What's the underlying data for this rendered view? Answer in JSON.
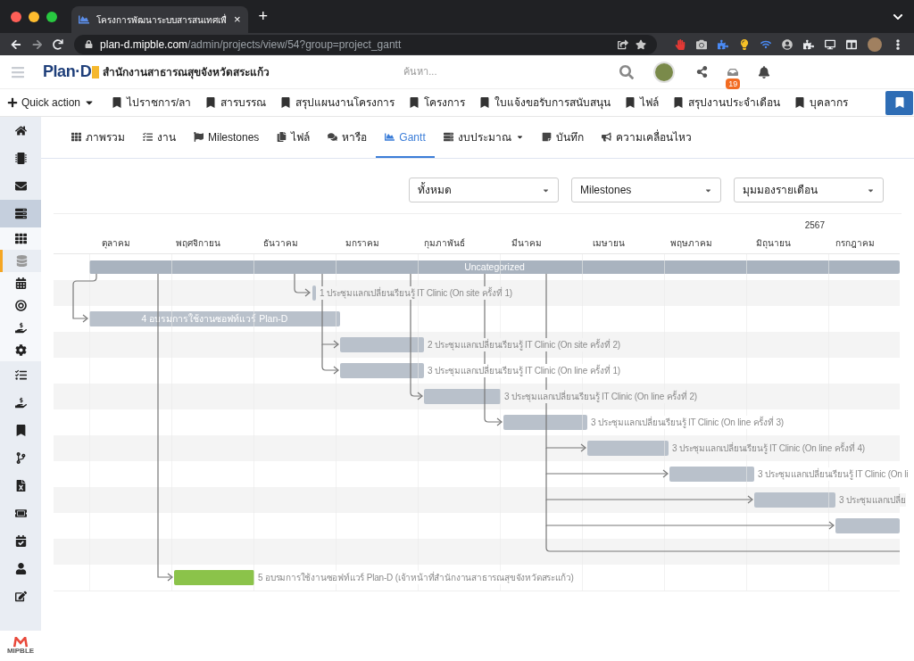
{
  "browser": {
    "tab_title": "โครงการพัฒนาระบบสารสนเทศเพื่",
    "tab_close": "×",
    "new_tab": "+",
    "url_host": "plan-d.mipble.com",
    "url_path": "/admin/projects/view/54?group=project_gantt"
  },
  "header": {
    "logo": "Plan·D",
    "organization": "สำนักงานสาธารณสุขจังหวัดสระแก้ว",
    "search": {
      "placeholder": "ค้นหา..."
    },
    "inbox_badge": "19"
  },
  "quick_bar": {
    "quick_action": "Quick action",
    "items": [
      "ไปราชการ/ลา",
      "สารบรรณ",
      "สรุปแผนงานโครงการ",
      "โครงการ",
      "ใบแจ้งขอรับการสนับสนุน",
      "ไฟล์",
      "สรุปงานประจำเดือน",
      "บุคลากร"
    ]
  },
  "sidebar": {
    "items": [
      {
        "kind": "main",
        "selected": false
      },
      {
        "kind": "main",
        "selected": false
      },
      {
        "kind": "main",
        "selected": false
      },
      {
        "kind": "main",
        "selected": true
      },
      {
        "kind": "sub",
        "selected": false
      },
      {
        "kind": "sub",
        "selected": true
      },
      {
        "kind": "sub",
        "selected": false
      },
      {
        "kind": "sub",
        "selected": false
      },
      {
        "kind": "sub",
        "selected": false
      },
      {
        "kind": "sub",
        "selected": false
      },
      {
        "kind": "main",
        "selected": false
      },
      {
        "kind": "main",
        "selected": false
      },
      {
        "kind": "main",
        "selected": false
      },
      {
        "kind": "main",
        "selected": false
      },
      {
        "kind": "main",
        "selected": false
      },
      {
        "kind": "main",
        "selected": false
      },
      {
        "kind": "main",
        "selected": false
      },
      {
        "kind": "main",
        "selected": false
      },
      {
        "kind": "main",
        "selected": false
      }
    ],
    "logo": "MIPBLE"
  },
  "tabs": [
    {
      "label": "ภาพรวม",
      "selected": false,
      "dropdown": false
    },
    {
      "label": "งาน",
      "selected": false,
      "dropdown": false
    },
    {
      "label": "Milestones",
      "selected": false,
      "dropdown": false
    },
    {
      "label": "ไฟล์",
      "selected": false,
      "dropdown": false
    },
    {
      "label": "หารือ",
      "selected": false,
      "dropdown": false
    },
    {
      "label": "Gantt",
      "selected": true,
      "dropdown": false
    },
    {
      "label": "งบประมาณ",
      "selected": false,
      "dropdown": true
    },
    {
      "label": "บันทึก",
      "selected": false,
      "dropdown": false
    },
    {
      "label": "ความเคลื่อนไหว",
      "selected": false,
      "dropdown": false
    }
  ],
  "filters": [
    {
      "value": "ทั้งหมด"
    },
    {
      "value": "Milestones"
    },
    {
      "value": "มุมมองรายเดือน"
    }
  ],
  "gantt": {
    "year": "2567",
    "months": [
      "ตุลาคม",
      "พฤศจิกายน",
      "ธันวาคม",
      "มกราคม",
      "กุมภาพันธ์",
      "มีนาคม",
      "เมษายน",
      "พฤษภาคม",
      "มิถุนายน",
      "กรกฎาคม"
    ],
    "rows": [
      {
        "kind": "group",
        "label": "Uncategorized",
        "color": "#a9b3bf"
      },
      {
        "kind": "task",
        "label": "1 ประชุมแลกเปลี่ยนเรียนรู้ IT Clinic (On site ครั้งที่ 1)",
        "color": "#b9c1cb"
      },
      {
        "kind": "inline",
        "label": "4 อบรมการใช้งานซอฟท์แวร์ Plan-D",
        "color": "#b9c1cb"
      },
      {
        "kind": "task",
        "label": "2 ประชุมแลกเปลี่ยนเรียนรู้ IT Clinic (On site ครั้งที่ 2)",
        "color": "#b9c1cb"
      },
      {
        "kind": "task",
        "label": "3 ประชุมแลกเปลี่ยนเรียนรู้ IT Clinic (On line ครั้งที่ 1)",
        "color": "#b9c1cb"
      },
      {
        "kind": "task",
        "label": "3 ประชุมแลกเปลี่ยนเรียนรู้ IT Clinic (On line ครั้งที่ 2)",
        "color": "#b9c1cb"
      },
      {
        "kind": "task",
        "label": "3 ประชุมแลกเปลี่ยนเรียนรู้ IT Clinic (On line ครั้งที่ 3)",
        "color": "#b9c1cb"
      },
      {
        "kind": "task",
        "label": "3 ประชุมแลกเปลี่ยนเรียนรู้ IT Clinic (On line ครั้งที่ 4)",
        "color": "#b9c1cb"
      },
      {
        "kind": "task",
        "label": "3 ประชุมแลกเปลี่ยนเรียนรู้ IT Clinic (On li",
        "color": "#b9c1cb"
      },
      {
        "kind": "task",
        "label": "3 ประชุมแลกเปลี่ย",
        "color": "#b9c1cb"
      },
      {
        "kind": "task",
        "color": "#b9c1cb"
      },
      {
        "kind": "empty"
      },
      {
        "kind": "task",
        "label": "5 อบรมการใช้งานซอฟท์แวร์ Plan-D (เจ้าหน้าที่สำนักงานสาธารณสุขจังหวัดสระแก้ว)",
        "color": "#8bc34a"
      }
    ]
  }
}
